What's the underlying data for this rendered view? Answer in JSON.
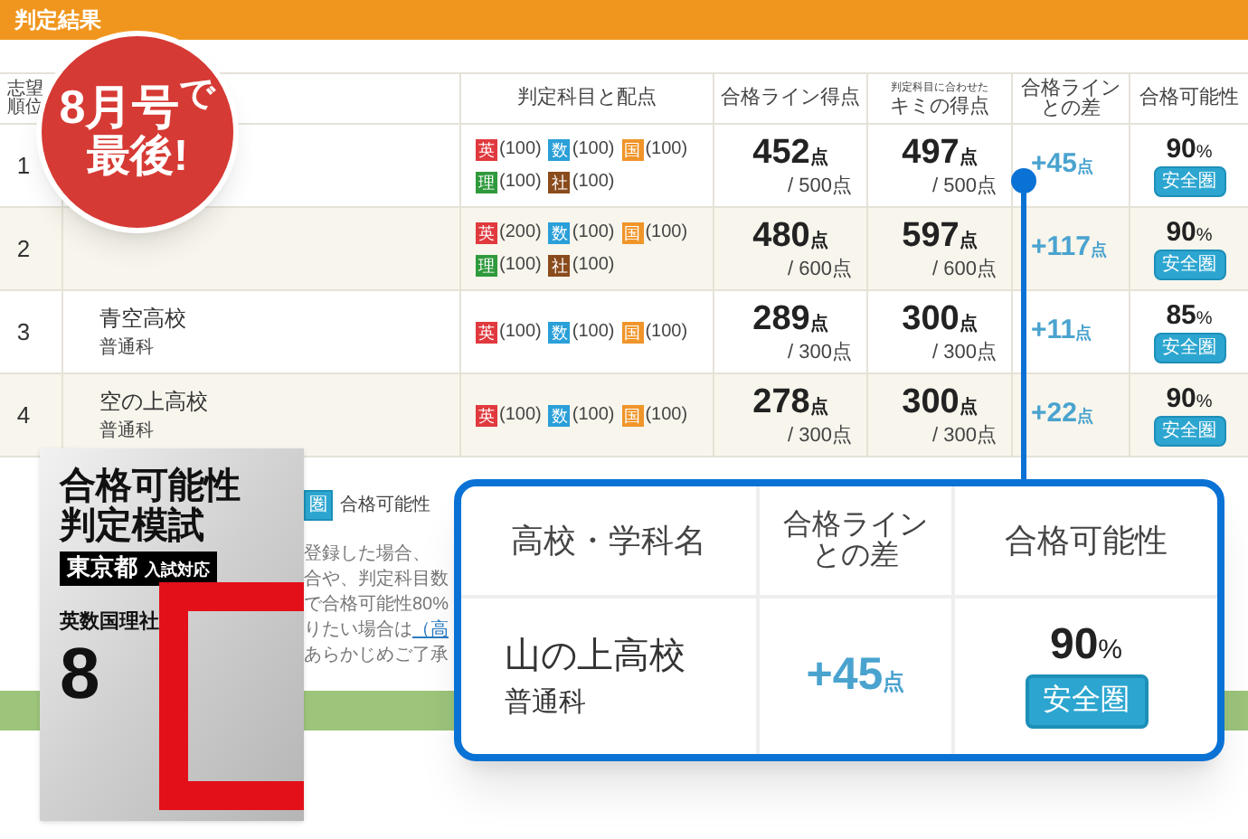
{
  "header": {
    "title": "判定結果"
  },
  "table": {
    "header": {
      "rank": [
        "志望",
        "順位"
      ],
      "subjects": "判定科目と配点",
      "pass_line": "合格ライン得点",
      "your_score_note": "判定科目に合わせた",
      "your_score": "キミの得点",
      "difference": [
        "合格ライン",
        "との差"
      ],
      "possibility": "合格可能性"
    },
    "rows": [
      {
        "rank": "1",
        "subjects": [
          {
            "label": "英",
            "color": "#e0393e",
            "points": "(100)"
          },
          {
            "label": "数",
            "color": "#2a9fd8",
            "points": "(100)"
          },
          {
            "label": "国",
            "color": "#f0952a",
            "points": "(100)"
          },
          {
            "label": "理",
            "color": "#2f9a3c",
            "points": "(100)"
          },
          {
            "label": "社",
            "color": "#8a4b1c",
            "points": "(100)"
          }
        ],
        "pass_line": {
          "score": "452",
          "unit": "点",
          "total": "/ 500点"
        },
        "your_score": {
          "score": "497",
          "unit": "点",
          "total": "/ 500点"
        },
        "difference": {
          "value": "+45",
          "unit": "点"
        },
        "possibility": {
          "value": "90",
          "unit": "%",
          "zone": "安全圏"
        }
      },
      {
        "rank": "2",
        "subjects": [
          {
            "label": "英",
            "color": "#e0393e",
            "points": "(200)"
          },
          {
            "label": "数",
            "color": "#2a9fd8",
            "points": "(100)"
          },
          {
            "label": "国",
            "color": "#f0952a",
            "points": "(100)"
          },
          {
            "label": "理",
            "color": "#2f9a3c",
            "points": "(100)"
          },
          {
            "label": "社",
            "color": "#8a4b1c",
            "points": "(100)"
          }
        ],
        "pass_line": {
          "score": "480",
          "unit": "点",
          "total": "/ 600点"
        },
        "your_score": {
          "score": "597",
          "unit": "点",
          "total": "/ 600点"
        },
        "difference": {
          "value": "+117",
          "unit": "点"
        },
        "possibility": {
          "value": "90",
          "unit": "%",
          "zone": "安全圏"
        }
      },
      {
        "rank": "3",
        "school": "青空高校",
        "course": "普通科",
        "subjects": [
          {
            "label": "英",
            "color": "#e0393e",
            "points": "(100)"
          },
          {
            "label": "数",
            "color": "#2a9fd8",
            "points": "(100)"
          },
          {
            "label": "国",
            "color": "#f0952a",
            "points": "(100)"
          }
        ],
        "pass_line": {
          "score": "289",
          "unit": "点",
          "total": "/ 300点"
        },
        "your_score": {
          "score": "300",
          "unit": "点",
          "total": "/ 300点"
        },
        "difference": {
          "value": "+11",
          "unit": "点"
        },
        "possibility": {
          "value": "85",
          "unit": "%",
          "zone": "安全圏"
        }
      },
      {
        "rank": "4",
        "school": "空の上高校",
        "course": "普通科",
        "subjects": [
          {
            "label": "英",
            "color": "#e0393e",
            "points": "(100)"
          },
          {
            "label": "数",
            "color": "#2a9fd8",
            "points": "(100)"
          },
          {
            "label": "国",
            "color": "#f0952a",
            "points": "(100)"
          }
        ],
        "pass_line": {
          "score": "278",
          "unit": "点",
          "total": "/ 300点"
        },
        "your_score": {
          "score": "300",
          "unit": "点",
          "total": "/ 300点"
        },
        "difference": {
          "value": "+22",
          "unit": "点"
        },
        "possibility": {
          "value": "90",
          "unit": "%",
          "zone": "安全圏"
        }
      }
    ]
  },
  "legend": {
    "badge": "圏",
    "text": "合格可能性"
  },
  "notes": [
    {
      "text": "登録した場合、"
    },
    {
      "text": "合や、判定科目数"
    },
    {
      "text": "で合格可能性80%"
    },
    {
      "text": "りたい場合は",
      "link": "（高"
    },
    {
      "text": "あらかじめご了承"
    }
  ],
  "promo_badge": {
    "line1": "8月号$^{で}$",
    "line2": "最後!"
  },
  "book": {
    "title": [
      "合格可能性",
      "判定模試"
    ],
    "region": "東京都",
    "region_note": "入試対応",
    "subjects": "英数国理社",
    "number": "8"
  },
  "callout": {
    "columns": [
      [
        "高校・学科名"
      ],
      [
        "合格ライン",
        "との差"
      ],
      [
        "合格可能性"
      ]
    ],
    "row": {
      "school": "山の上高校",
      "course": "普通科",
      "difference": {
        "value": "+45",
        "unit": "点"
      },
      "possibility": {
        "value": "90",
        "unit": "%",
        "zone": "安全圏"
      }
    }
  }
}
